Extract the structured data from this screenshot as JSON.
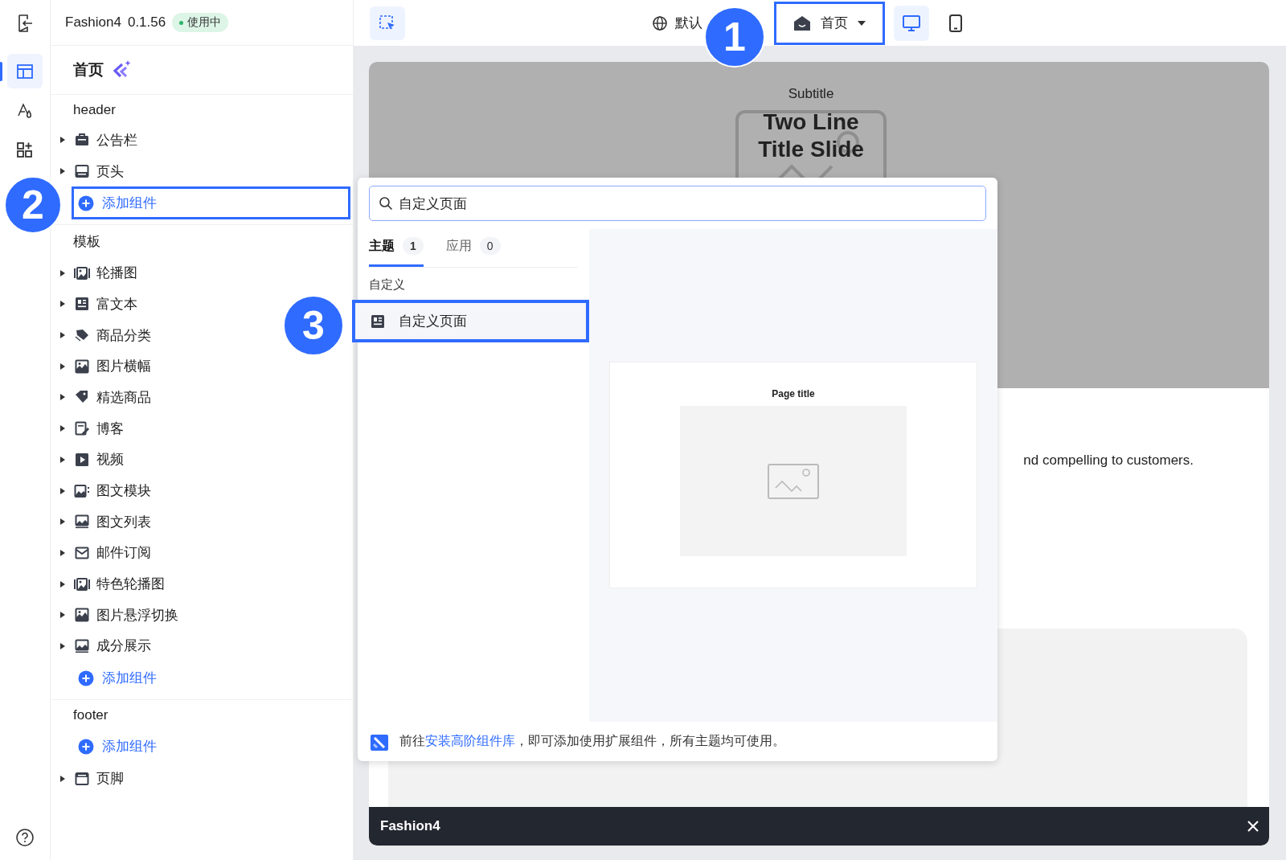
{
  "rail_tabs": [
    {
      "selected": true
    },
    {
      "selected": false
    },
    {
      "selected": false
    }
  ],
  "app": {
    "name": "Fashion4",
    "version": "0.1.56",
    "status": "使用中"
  },
  "toolbar": {
    "language": "默认",
    "page_select": {
      "label": "首页",
      "highlighted": true
    },
    "devices": [
      {
        "selected": true
      },
      {
        "selected": false
      }
    ]
  },
  "page_title": "首页",
  "sections": [
    {
      "title": "header",
      "items": [
        {
          "kind": "component",
          "label": "公告栏",
          "expanded": false
        },
        {
          "kind": "component",
          "label": "页头",
          "expanded": false
        },
        {
          "kind": "add",
          "label": "添加组件",
          "highlighted": true
        }
      ]
    },
    {
      "title": "模板",
      "items": [
        {
          "kind": "component",
          "label": "轮播图",
          "expanded": false
        },
        {
          "kind": "component",
          "label": "富文本",
          "expanded": false
        },
        {
          "kind": "component",
          "label": "商品分类",
          "expanded": false
        },
        {
          "kind": "component",
          "label": "图片横幅",
          "expanded": false
        },
        {
          "kind": "component",
          "label": "精选商品",
          "expanded": false
        },
        {
          "kind": "component",
          "label": "博客",
          "expanded": false
        },
        {
          "kind": "component",
          "label": "视频",
          "expanded": false
        },
        {
          "kind": "component",
          "label": "图文模块",
          "expanded": false
        },
        {
          "kind": "component",
          "label": "图文列表",
          "expanded": false
        },
        {
          "kind": "component",
          "label": "邮件订阅",
          "expanded": false
        },
        {
          "kind": "component",
          "label": "特色轮播图",
          "expanded": false
        },
        {
          "kind": "component",
          "label": "图片悬浮切换",
          "expanded": false
        },
        {
          "kind": "component",
          "label": "成分展示",
          "expanded": false
        },
        {
          "kind": "add",
          "label": "添加组件",
          "highlighted": false
        }
      ]
    },
    {
      "title": "footer",
      "items": [
        {
          "kind": "add",
          "label": "添加组件",
          "highlighted": false
        },
        {
          "kind": "component",
          "label": "页脚",
          "expanded": false
        }
      ]
    }
  ],
  "preview": {
    "subtitle": "Subtitle",
    "title_lines": [
      "Two Line",
      "Title Slide"
    ],
    "body_text": "nd compelling to customers.",
    "bottom_bar": "Fashion4"
  },
  "popup": {
    "search": "自定义页面",
    "tabs": [
      {
        "label": "主题",
        "count": "1",
        "selected": true
      },
      {
        "label": "应用",
        "count": "0",
        "selected": false
      }
    ],
    "group": "自定义",
    "results": [
      {
        "label": "自定义页面",
        "selected": true
      }
    ],
    "preview_title": "Page title",
    "footer": {
      "before": "前往",
      "link": "安装高阶组件库",
      "after": "，即可添加使用扩展组件，所有主题均可使用。"
    }
  },
  "callouts": [
    "1",
    "2",
    "3"
  ]
}
